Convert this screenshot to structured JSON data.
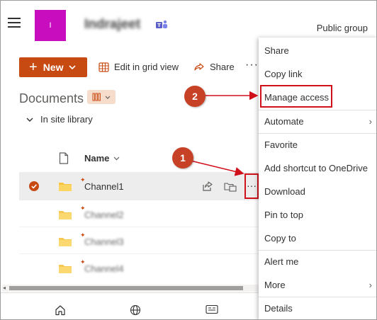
{
  "header": {
    "site_logo_letter": "I",
    "site_name": "Indrajeet",
    "group_type": "Public group"
  },
  "command_bar": {
    "new_label": "New",
    "edit_grid_label": "Edit in grid view",
    "share_label": "Share",
    "more_label": "···"
  },
  "library": {
    "title": "Documents",
    "section": "In site library",
    "name_column": "Name"
  },
  "rows": [
    {
      "name": "Channel1",
      "selected": true
    },
    {
      "name": "Channel2",
      "selected": false
    },
    {
      "name": "Channel3",
      "selected": false
    },
    {
      "name": "Channel4",
      "selected": false
    }
  ],
  "context_menu": {
    "items": [
      {
        "label": "Share"
      },
      {
        "label": "Copy link"
      },
      {
        "label": "Manage access"
      },
      {
        "label": "Automate",
        "submenu": true
      },
      {
        "label": "Favorite"
      },
      {
        "label": "Add shortcut to OneDrive"
      },
      {
        "label": "Download"
      },
      {
        "label": "Pin to top"
      },
      {
        "label": "Copy to"
      },
      {
        "label": "Alert me"
      },
      {
        "label": "More",
        "submenu": true
      },
      {
        "label": "Details"
      }
    ]
  },
  "annotations": {
    "step1": "1",
    "step2": "2"
  },
  "colors": {
    "brand": "#c84a13",
    "site_logo": "#c70dbd",
    "annotation_red": "#d0101b",
    "badge": "#c64125"
  },
  "icons": {
    "menu": "hamburger-icon",
    "teams": "teams-icon",
    "edit_grid": "grid-icon",
    "share": "share-icon",
    "view": "library-view-icon",
    "file": "file-icon",
    "folder": "folder-icon",
    "home": "home-icon",
    "globe": "globe-icon",
    "news": "news-icon"
  }
}
